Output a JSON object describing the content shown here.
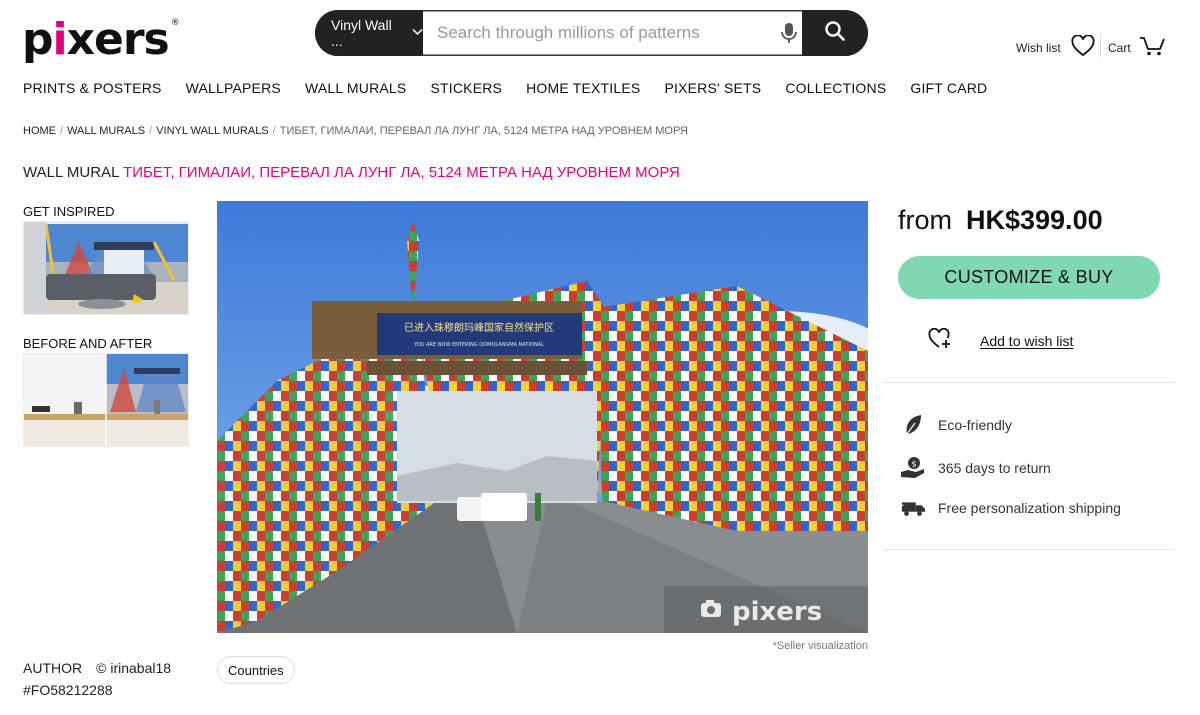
{
  "brand": {
    "logo_text_a": "p",
    "logo_dot": "i",
    "logo_text_b": "xers",
    "logo_mark": "®"
  },
  "search": {
    "category": "Vinyl Wall ...",
    "placeholder": "Search through millions of patterns"
  },
  "header": {
    "wish_label": "Wish list",
    "cart_label": "Cart"
  },
  "nav": [
    "PRINTS & POSTERS",
    "WALLPAPERS",
    "WALL MURALS",
    "STICKERS",
    "HOME TEXTILES",
    "PIXERS' SETS",
    "COLLECTIONS",
    "GIFT CARD"
  ],
  "breadcrumb": [
    "HOME",
    "WALL MURALS",
    "VINYL WALL MURALS",
    "ТИБЕТ, ГИМАЛАИ, ПЕРЕВАЛ ЛА ЛУНГ ЛА, 5124 МЕТРА НАД УРОВНЕМ МОРЯ"
  ],
  "breadcrumb_sep": "/",
  "title": {
    "prefix": "WALL MURAL ",
    "p1": "ТИБЕТ",
    "c1": ", ",
    "p2": "ГИМАЛАИ",
    "c2": ", ",
    "p3": "ПЕРЕВАЛ ЛА ЛУНГ ЛА",
    "c3": ", 5124 ",
    "p4": "МЕТРА НАД УРОВНЕМ МОРЯ"
  },
  "left": {
    "inspired": "GET INSPIRED",
    "before_after": "BEFORE AND AFTER"
  },
  "image": {
    "watermark": "pixers",
    "seller_note": "*Seller visualization",
    "sign_text": "已进入珠穆朗玛峰国家自然保护区",
    "sign_subtext": "YOU ARE NOW ENTERING QOMOLANGMA NATIONAL"
  },
  "purchase": {
    "from": "from",
    "price": "HK$399.00",
    "buy_label": "CUSTOMIZE & BUY",
    "wish_label": "Add to wish list"
  },
  "features": [
    "Eco-friendly",
    "365 days to return",
    "Free personalization shipping"
  ],
  "meta": {
    "author_label": "AUTHOR",
    "author_name": "© irinabal18",
    "product_id": "#FO58212288",
    "tag": "Countries"
  },
  "colors": {
    "accent_pink": "#e6007e",
    "buy_green": "#7fd8b2",
    "dark": "#222222"
  }
}
